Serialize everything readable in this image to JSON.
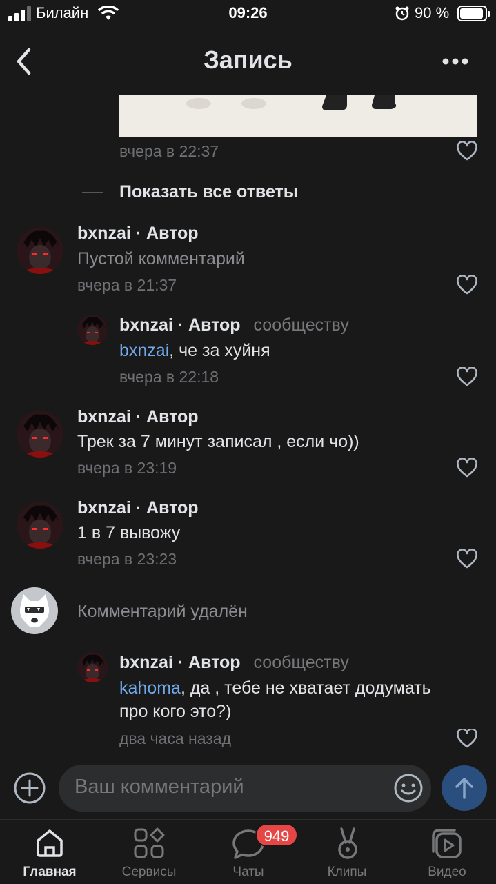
{
  "status_bar": {
    "carrier": "Билайн",
    "time": "09:26",
    "battery_percent": "90 %"
  },
  "header": {
    "title": "Запись"
  },
  "top_comment": {
    "time": "вчера в 22:37"
  },
  "show_all_replies_label": "Показать все ответы",
  "comments": [
    {
      "name": "bxnzai",
      "role": "· Автор",
      "text": "Пустой комментарий",
      "time": "вчера в 21:37"
    },
    {
      "name": "bxnzai",
      "role": "· Автор",
      "community": "сообществу",
      "mention": "bxnzai",
      "text": ", че за хуйня",
      "time": "вчера в 22:18"
    },
    {
      "name": "bxnzai",
      "role": "· Автор",
      "text": "Трек за 7 минут записал , если чо))",
      "time": "вчера в 23:19"
    },
    {
      "name": "bxnzai",
      "role": "· Автор",
      "text": "1 в 7 вывожу",
      "time": "вчера в 23:23"
    },
    {
      "deleted_text": "Комментарий удалён"
    },
    {
      "name": "bxnzai",
      "role": "· Автор",
      "community": "сообществу",
      "mention": "kahoma",
      "text_line1": ", да , тебе не хватает додумать",
      "text_line2": "про кого это?)",
      "time": "два часа назад"
    }
  ],
  "composer": {
    "placeholder": "Ваш комментарий"
  },
  "tabbar": {
    "tabs": [
      {
        "label": "Главная",
        "active": true
      },
      {
        "label": "Сервисы"
      },
      {
        "label": "Чаты"
      },
      {
        "label": "Клипы"
      },
      {
        "label": "Видео"
      }
    ],
    "chats_badge": "949"
  },
  "colors": {
    "background": "#19191a",
    "mention": "#71aaeb",
    "badge": "#e64646",
    "send_button": "#2a4e7e"
  }
}
